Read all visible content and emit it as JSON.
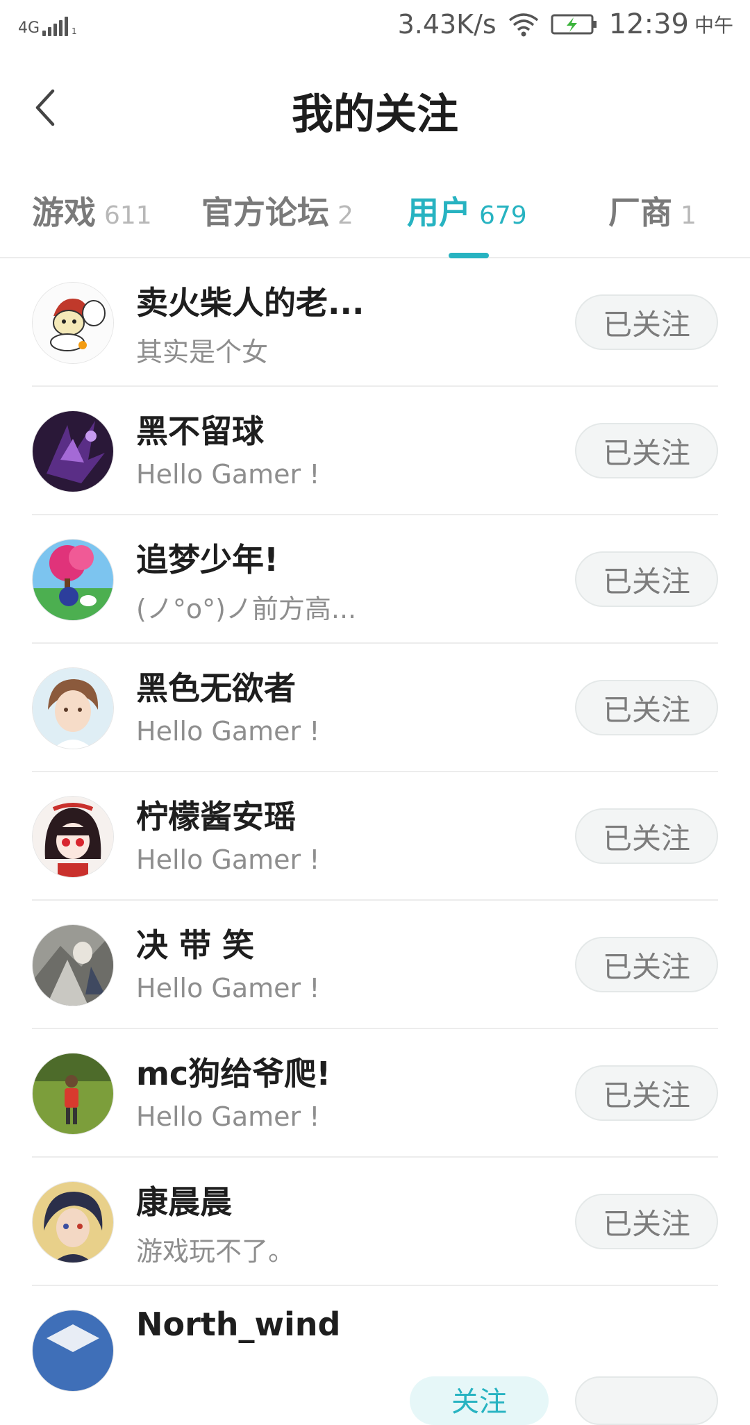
{
  "status_bar": {
    "network": "4G",
    "network_sub": "1",
    "speed": "3.43K/s",
    "time": "12:39",
    "ampm": "中午",
    "icons": [
      "signal-icon",
      "wifi-icon",
      "battery-charging-icon"
    ]
  },
  "header": {
    "title": "我的关注",
    "back_icon": "chevron-left-icon"
  },
  "tabs": [
    {
      "label": "游戏",
      "count": "611"
    },
    {
      "label": "官方论坛",
      "count": "2"
    },
    {
      "label": "用户",
      "count": "679",
      "active": true
    },
    {
      "label": "厂商",
      "count": "1"
    }
  ],
  "colors": {
    "accent": "#27b3c1",
    "button_bg": "#f3f5f5",
    "text_secondary": "#8e8e8e"
  },
  "users": [
    {
      "name": "卖火柴人的老...",
      "signature": "其实是个女",
      "button": "已关注"
    },
    {
      "name": "黑不留球",
      "signature": "Hello Gamer !",
      "button": "已关注"
    },
    {
      "name": "追梦少年!",
      "signature": "(ノ°o°)ノ前方高...",
      "button": "已关注"
    },
    {
      "name": "黑色无欲者",
      "signature": "Hello Gamer !",
      "button": "已关注"
    },
    {
      "name": "柠檬酱安瑶",
      "signature": "Hello Gamer !",
      "button": "已关注"
    },
    {
      "name": "决 带 笑",
      "signature": "Hello Gamer !",
      "button": "已关注"
    },
    {
      "name": "mc狗给爷爬!",
      "signature": "Hello Gamer !",
      "button": "已关注"
    },
    {
      "name": "康晨晨",
      "signature": "游戏玩不了。",
      "button": "已关注"
    },
    {
      "name": "North_wind",
      "signature": "",
      "button": "关注",
      "partial": true
    }
  ]
}
